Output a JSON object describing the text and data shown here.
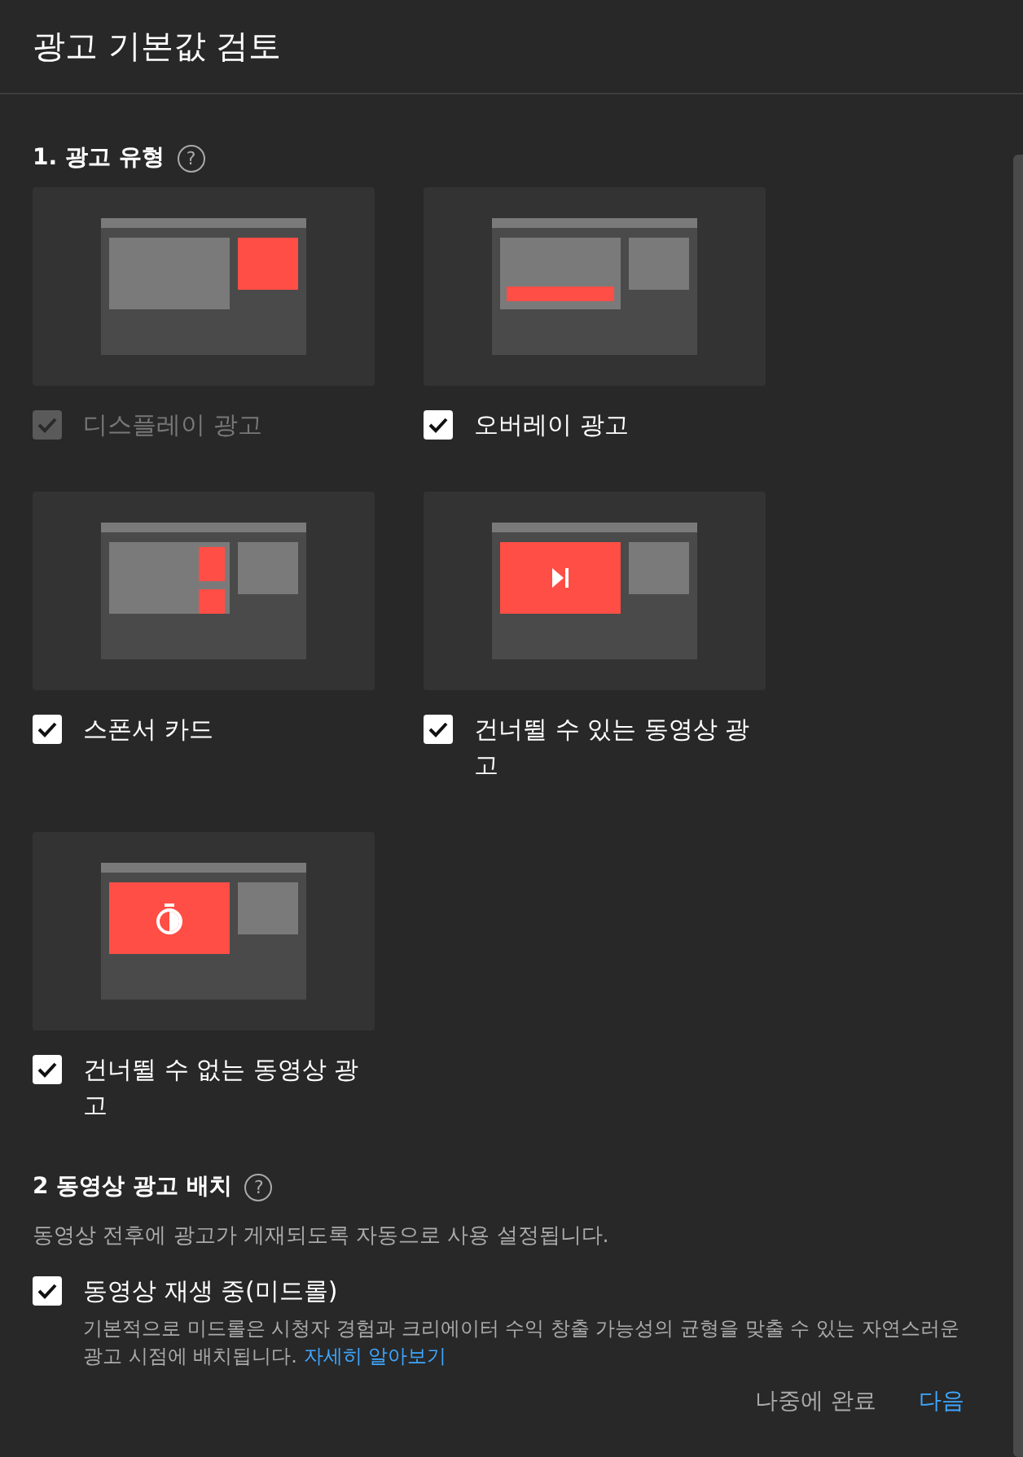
{
  "dialog": {
    "title": "광고 기본값 검토"
  },
  "ad_types_section": {
    "heading": "1. 광고 유형",
    "help_icon": "?",
    "items": [
      {
        "kind": "display",
        "label": "디스플레이 광고",
        "checked": true,
        "disabled": true
      },
      {
        "kind": "overlay",
        "label": "오버레이 광고",
        "checked": true,
        "disabled": false
      },
      {
        "kind": "sponsor",
        "label": "스폰서 카드",
        "checked": true,
        "disabled": false
      },
      {
        "kind": "skippable",
        "label": "건너뛸 수 있는 동영상 광고",
        "checked": true,
        "disabled": false
      },
      {
        "kind": "nonskippable",
        "label": "건너뛸 수 없는 동영상 광고",
        "checked": true,
        "disabled": false
      }
    ]
  },
  "placement_section": {
    "heading": "2 동영상 광고 배치",
    "help_icon": "?",
    "description": "동영상 전후에 광고가 게재되도록 자동으로 사용 설정됩니다.",
    "option": {
      "label": "동영상 재생 중(미드롤)",
      "checked": true,
      "description": "기본적으로 미드롤은 시청자 경험과 크리에이터 수익 창출 가능성의 균형을 맞출 수 있는 자연스러운 광고 시점에 배치됩니다.",
      "link": "자세히 알아보기"
    }
  },
  "footer": {
    "buttons": [
      {
        "label": "나중에 완료",
        "primary": false
      },
      {
        "label": "다음",
        "primary": true
      }
    ]
  }
}
